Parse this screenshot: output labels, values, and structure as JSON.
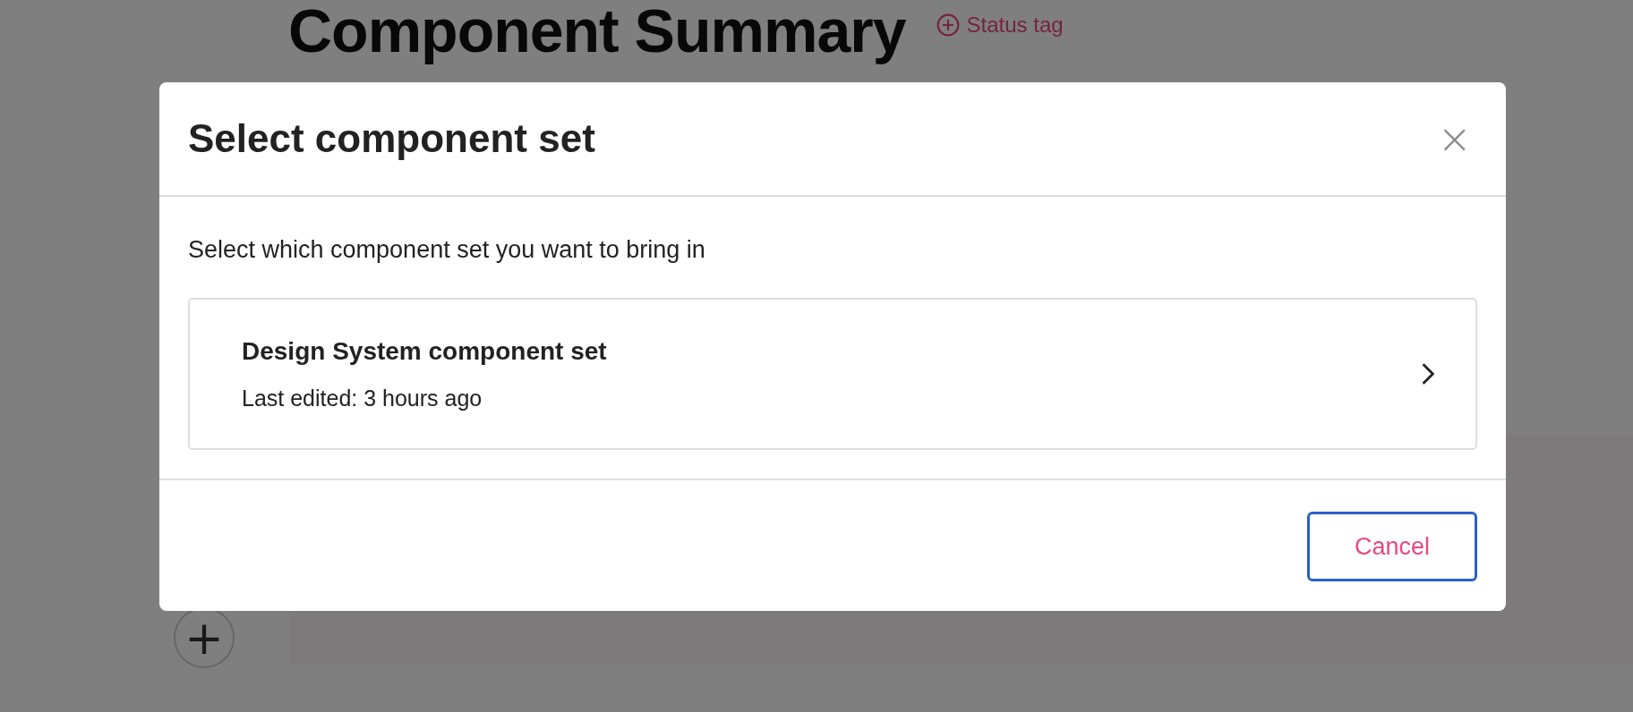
{
  "page": {
    "heading": "Component Summary",
    "status_tag": "Status tag",
    "add_button": "+"
  },
  "dialog": {
    "title": "Select component set",
    "close": "×",
    "prompt": "Select which component set you want to bring in",
    "options": [
      {
        "name": "Design System component set",
        "meta": "Last edited: 3 hours ago"
      }
    ],
    "buttons": [
      {
        "label": "Cancel",
        "focused": true
      }
    ]
  }
}
